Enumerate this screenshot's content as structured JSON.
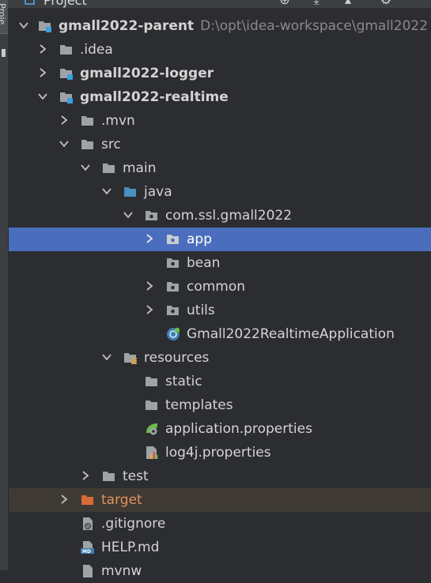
{
  "panel": {
    "title": "Project",
    "side_tab": "Proje",
    "colors": {
      "selected": "#4a6ebd",
      "excluded_bg": "#3f3a33",
      "excluded_text": "#e1925e",
      "module_badge": "#3aa0e0",
      "folder": "#9ea3a8",
      "source_folder": "#4b8fbf"
    }
  },
  "tree": [
    {
      "label": "gmall2022-parent",
      "path": "D:\\opt\\idea-workspace\\gmall2022",
      "icon": "module-folder-icon",
      "expanded": true,
      "bold": true
    },
    {
      "label": ".idea",
      "icon": "folder-icon",
      "expanded": false
    },
    {
      "label": "gmall2022-logger",
      "icon": "module-folder-icon",
      "expanded": false,
      "bold": true
    },
    {
      "label": "gmall2022-realtime",
      "icon": "module-folder-icon",
      "expanded": true,
      "bold": true
    },
    {
      "label": ".mvn",
      "icon": "folder-icon",
      "expanded": false
    },
    {
      "label": "src",
      "icon": "folder-icon",
      "expanded": true
    },
    {
      "label": "main",
      "icon": "folder-icon",
      "expanded": true
    },
    {
      "label": "java",
      "icon": "source-folder-icon",
      "expanded": true
    },
    {
      "label": "com.ssl.gmall2022",
      "icon": "package-icon",
      "expanded": true
    },
    {
      "label": "app",
      "icon": "package-icon",
      "expanded": false,
      "selected": true
    },
    {
      "label": "bean",
      "icon": "package-icon"
    },
    {
      "label": "common",
      "icon": "package-icon",
      "expanded": false
    },
    {
      "label": "utils",
      "icon": "package-icon",
      "expanded": false
    },
    {
      "label": "Gmall2022RealtimeApplication",
      "icon": "spring-boot-class-icon"
    },
    {
      "label": "resources",
      "icon": "resources-folder-icon",
      "expanded": true
    },
    {
      "label": "static",
      "icon": "folder-icon"
    },
    {
      "label": "templates",
      "icon": "folder-icon"
    },
    {
      "label": "application.properties",
      "icon": "spring-properties-icon"
    },
    {
      "label": "log4j.properties",
      "icon": "properties-file-icon"
    },
    {
      "label": "test",
      "icon": "folder-icon",
      "expanded": false
    },
    {
      "label": "target",
      "icon": "excluded-folder-icon",
      "expanded": false,
      "excluded": true
    },
    {
      "label": ".gitignore",
      "icon": "gitignore-file-icon"
    },
    {
      "label": "HELP.md",
      "icon": "markdown-file-icon"
    },
    {
      "label": "mvnw",
      "icon": "file-icon"
    }
  ]
}
